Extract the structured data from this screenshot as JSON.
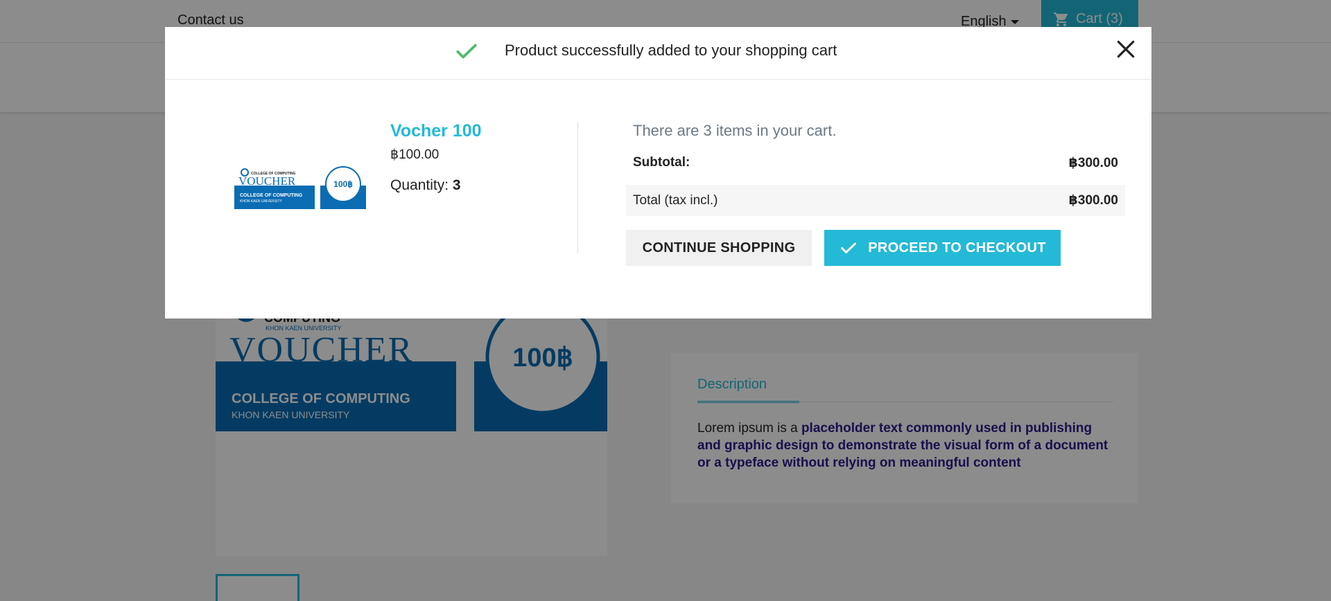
{
  "topnav": {
    "contact_label": "Contact us",
    "language_label": "English",
    "cart_label": "Cart (3)"
  },
  "background": {
    "description_tab_label": "Description",
    "description_text_plain": "Lorem ipsum is a ",
    "description_text_bold": "placeholder text commonly used in publishing and graphic design to demonstrate the visual form of a document or a typeface without relying on meaningful content",
    "voucher_brand": "COMPUTING",
    "voucher_univ": "KHON KAEN UNIVERSITY",
    "voucher_word": "VOUCHER",
    "voucher_college": "COLLEGE OF COMPUTING",
    "voucher_univ_caps": "KHON KAEN UNIVERSITY",
    "voucher_badge": "100฿"
  },
  "modal": {
    "title": "Product successfully added to your shopping cart",
    "product": {
      "name": "Vocher 100",
      "price": "฿100.00",
      "quantity_label": "Quantity: ",
      "quantity_value": "3",
      "image_brand": "COLLEGE OF COMPUTING",
      "image_word": "VOUCHER",
      "image_college": "COLLEGE OF COMPUTING",
      "image_univ": "KHON KAEN UNIVERSITY",
      "image_badge": "100฿"
    },
    "summary": {
      "cart_count_text": "There are 3 items in your cart.",
      "subtotal_label": "Subtotal:",
      "subtotal_value": "฿300.00",
      "total_label": "Total (tax incl.)",
      "total_value": "฿300.00"
    },
    "buttons": {
      "continue_label": "CONTINUE SHOPPING",
      "checkout_label": "PROCEED TO CHECKOUT"
    }
  },
  "colors": {
    "accent": "#24b9d7",
    "success_check": "#4cbb6c",
    "voucher_blue": "#0a6cb3"
  },
  "icons": {
    "success": "check-icon",
    "close": "close-icon",
    "cart": "cart-icon",
    "checkout": "check-icon"
  }
}
